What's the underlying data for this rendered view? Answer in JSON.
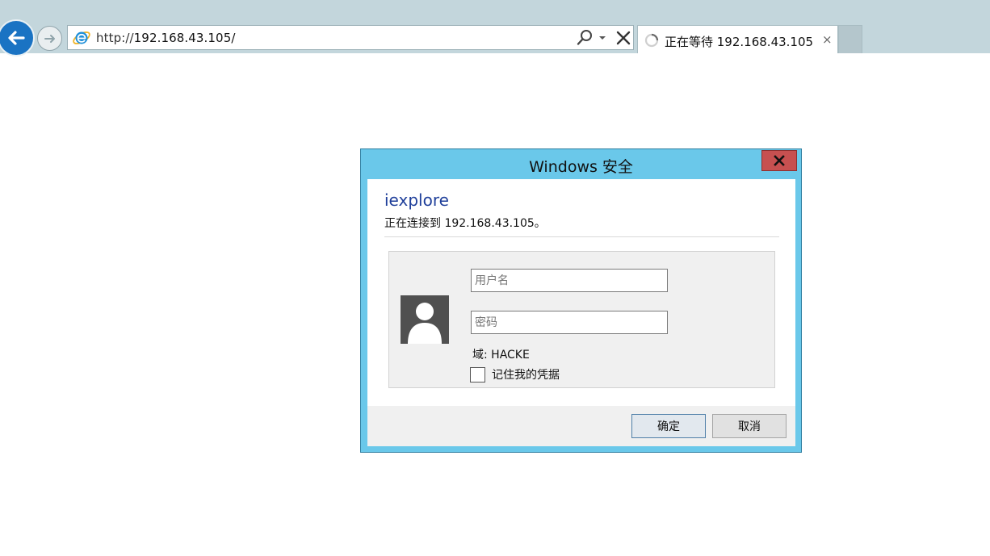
{
  "browser": {
    "address_bar": {
      "url_prefix": "http://",
      "url_host": "192.168.43.105/"
    },
    "tab": {
      "title": "正在等待 192.168.43.105",
      "close_glyph": "×"
    },
    "icons": {
      "back": "back-arrow-icon",
      "forward": "forward-arrow-icon",
      "site": "ie-logo-icon",
      "search": "search-icon",
      "dropdown": "chevron-down-icon",
      "stop": "close-icon",
      "loading": "loading-spinner-icon"
    }
  },
  "dialog": {
    "title": "Windows 安全",
    "close_glyph": "x",
    "app_name": "iexplore",
    "message": "正在连接到 192.168.43.105。",
    "username_placeholder": "用户名",
    "password_placeholder": "密码",
    "domain_label": "域: HACKE",
    "remember_label": "记住我的凭据",
    "remember_checked": false,
    "ok_label": "确定",
    "cancel_label": "取消"
  },
  "colors": {
    "chrome_bg": "#c3d6dc",
    "back_button": "#1a73c3",
    "dialog_frame": "#6ac8ea",
    "close_button": "#c75050",
    "app_name": "#1f3f9a"
  }
}
